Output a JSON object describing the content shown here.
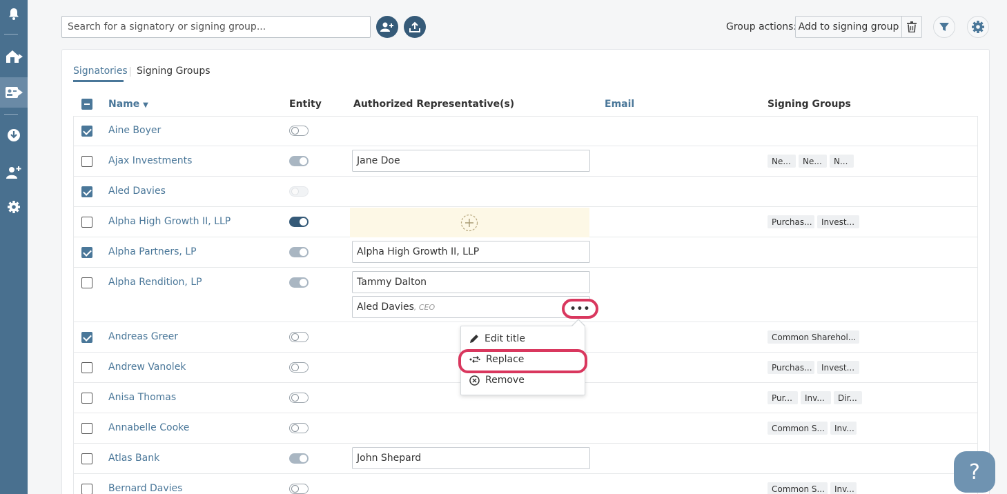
{
  "sidebar": {
    "icons": [
      "bell-icon",
      "home-icon",
      "signatories-icon",
      "download-icon",
      "add-person-icon",
      "gear-icon"
    ]
  },
  "search": {
    "placeholder": "Search for a signatory or signing group..."
  },
  "toolbar": {
    "group_actions_label": "Group actions:",
    "add_to_group_label": "Add to signing group"
  },
  "tabs": {
    "signatories": "Signatories",
    "signing_groups": "Signing Groups"
  },
  "columns": {
    "name": "Name",
    "entity": "Entity",
    "reps": "Authorized Representative(s)",
    "email": "Email",
    "groups": "Signing Groups"
  },
  "rows": [
    {
      "name": "Aine Boyer",
      "checked": true,
      "entity": "off",
      "reps": [],
      "groups": []
    },
    {
      "name": "Ajax Investments",
      "checked": false,
      "entity": "grey",
      "reps": [
        "Jane Doe"
      ],
      "groups": [
        "Ne...",
        "Ne...",
        "N..."
      ]
    },
    {
      "name": "Aled Davies",
      "checked": true,
      "entity": "faint",
      "reps": [],
      "groups": []
    },
    {
      "name": "Alpha High Growth II, LLP",
      "checked": false,
      "entity": "on",
      "reps": [],
      "groups": [
        "Purchas...",
        "Invest..."
      ]
    },
    {
      "name": "Alpha Partners, LP",
      "checked": true,
      "entity": "grey",
      "reps": [
        "Alpha High Growth II, LLP"
      ],
      "groups": []
    },
    {
      "name": "Alpha Rendition, LP",
      "checked": false,
      "entity": "grey",
      "reps": [
        "Tammy Dalton",
        "Aled Davies"
      ],
      "groups": []
    },
    {
      "name": "Andreas Greer",
      "checked": true,
      "entity": "off",
      "reps": [],
      "groups": [
        "Common Sharehol..."
      ]
    },
    {
      "name": "Andrew Vanolek",
      "checked": false,
      "entity": "off",
      "reps": [],
      "groups": [
        "Purchas...",
        "Invest..."
      ]
    },
    {
      "name": "Anisa Thomas",
      "checked": false,
      "entity": "off",
      "reps": [],
      "groups": [
        "Pur...",
        "Inv...",
        "Dir..."
      ]
    },
    {
      "name": "Annabelle Cooke",
      "checked": false,
      "entity": "off",
      "reps": [],
      "groups": [
        "Common S...",
        "Inv..."
      ]
    },
    {
      "name": "Atlas Bank",
      "checked": false,
      "entity": "grey",
      "reps": [
        "John Shepard"
      ],
      "groups": []
    },
    {
      "name": "Bernard Davies",
      "checked": false,
      "entity": "off",
      "reps": [],
      "groups": [
        "Common S...",
        "Inv..."
      ]
    }
  ],
  "rep_title": ", CEO",
  "more_label": "•••",
  "context_menu": {
    "edit_title": "Edit title",
    "replace": "Replace",
    "remove": "Remove"
  },
  "help": {
    "label": "?"
  }
}
